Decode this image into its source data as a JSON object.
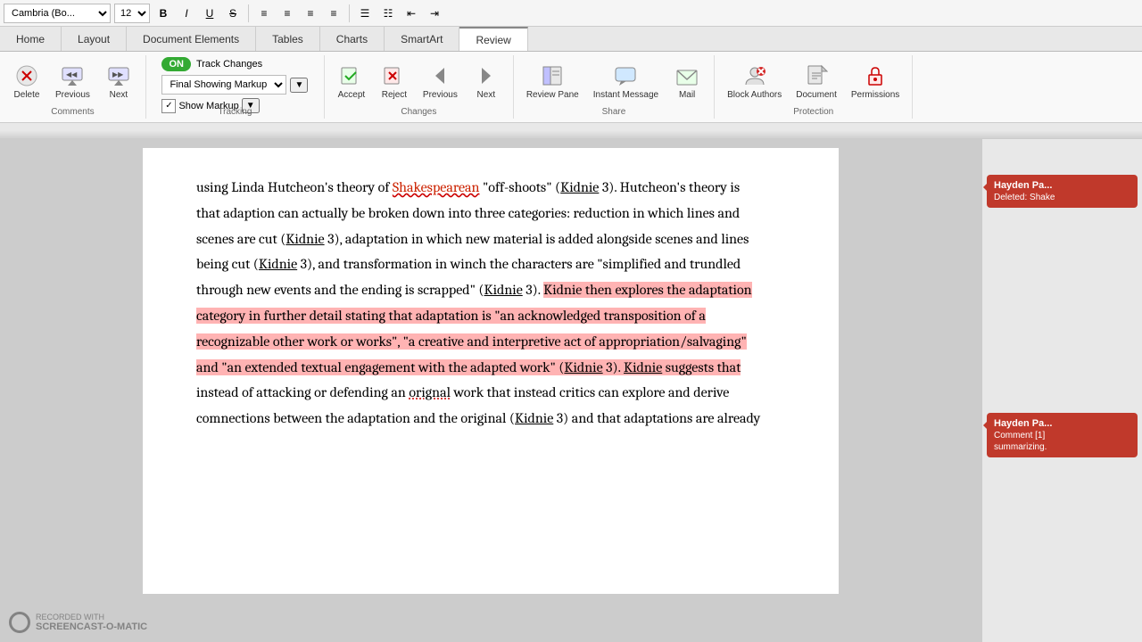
{
  "toolbar": {
    "font_name": "Cambria (Bo...",
    "font_size": "12",
    "bold": "B",
    "italic": "I",
    "underline": "U"
  },
  "tabs": [
    {
      "label": "Home",
      "active": false
    },
    {
      "label": "Layout",
      "active": false
    },
    {
      "label": "Document Elements",
      "active": false
    },
    {
      "label": "Tables",
      "active": false
    },
    {
      "label": "Charts",
      "active": false
    },
    {
      "label": "SmartArt",
      "active": false
    },
    {
      "label": "Review",
      "active": true
    }
  ],
  "ribbon": {
    "groups": [
      {
        "label": "Comments",
        "buttons": [
          {
            "id": "delete",
            "icon": "🗑",
            "label": "Delete"
          },
          {
            "id": "previous",
            "icon": "◀",
            "label": "Previous"
          },
          {
            "id": "next",
            "icon": "▶",
            "label": "Next"
          }
        ]
      },
      {
        "label": "Tracking",
        "track_changes_on": "ON",
        "track_changes_label": "Track Changes",
        "markup_value": "Final Showing Markup",
        "show_markup_label": "Show Markup"
      },
      {
        "label": "Changes",
        "buttons": [
          {
            "id": "accept",
            "icon": "✔",
            "label": "Accept"
          },
          {
            "id": "reject",
            "icon": "✘",
            "label": "Reject"
          },
          {
            "id": "previous",
            "icon": "◀",
            "label": "Previous"
          },
          {
            "id": "next",
            "icon": "▶",
            "label": "Next"
          }
        ]
      },
      {
        "label": "Share",
        "buttons": [
          {
            "id": "review-pane",
            "icon": "📋",
            "label": "Review Pane"
          },
          {
            "id": "instant-message",
            "icon": "💬",
            "label": "Instant Message"
          },
          {
            "id": "mail",
            "icon": "✉",
            "label": "Mail"
          }
        ]
      },
      {
        "label": "Protection",
        "buttons": [
          {
            "id": "block-authors",
            "icon": "🚫",
            "label": "Block Authors"
          },
          {
            "id": "document",
            "icon": "📄",
            "label": "Document"
          },
          {
            "id": "permissions",
            "icon": "🔒",
            "label": "Permissions"
          }
        ]
      }
    ]
  },
  "document": {
    "paragraphs": [
      {
        "id": "p1",
        "segments": [
          {
            "text": "using Linda Hutcheon’s theory of ",
            "style": "normal"
          },
          {
            "text": "Shakespearean",
            "style": "red-link"
          },
          {
            "text": " “off-shoots” (",
            "style": "normal"
          },
          {
            "text": "Kidnie",
            "style": "underline"
          },
          {
            "text": " 3). Hutcheon’s theory is",
            "style": "normal"
          }
        ]
      },
      {
        "id": "p2",
        "segments": [
          {
            "text": "that adaption can actually be broken down into three categories: reduction in which lines and",
            "style": "normal"
          }
        ]
      },
      {
        "id": "p3",
        "segments": [
          {
            "text": "scenes are cut (",
            "style": "normal"
          },
          {
            "text": "Kidnie",
            "style": "underline"
          },
          {
            "text": " 3), adaptation in which new material is added alongside scenes and lines",
            "style": "normal"
          }
        ]
      },
      {
        "id": "p4",
        "segments": [
          {
            "text": "being cut (",
            "style": "normal"
          },
          {
            "text": "Kidnie",
            "style": "underline"
          },
          {
            "text": " 3), and transformation in winch the characters are “simplified and trundled",
            "style": "normal"
          }
        ]
      },
      {
        "id": "p5",
        "segments": [
          {
            "text": "through new events and the ending is scrapped” (",
            "style": "normal"
          },
          {
            "text": "Kidnie",
            "style": "underline"
          },
          {
            "text": " 3). ",
            "style": "normal"
          },
          {
            "text": "Kidnie then explores the adaptation",
            "style": "highlighted"
          }
        ]
      },
      {
        "id": "p6",
        "segments": [
          {
            "text": "category in further detail stating that adaptation is “an acknowledged transposition of a",
            "style": "highlighted"
          }
        ]
      },
      {
        "id": "p7",
        "segments": [
          {
            "text": "recognizable other work or works”, “a creative and interpretive act of appropriation/salvaging”",
            "style": "highlighted"
          }
        ]
      },
      {
        "id": "p8",
        "segments": [
          {
            "text": "and “an extended textual engagement with the adapted work” (",
            "style": "highlighted"
          },
          {
            "text": "Kidnie",
            "style": "highlighted-underline"
          },
          {
            "text": " 3). ",
            "style": "highlighted"
          },
          {
            "text": "Kidnie",
            "style": "highlighted-underline"
          },
          {
            "text": " suggests that",
            "style": "highlighted"
          }
        ]
      },
      {
        "id": "p9",
        "segments": [
          {
            "text": "instead of attacking or defending an ",
            "style": "normal"
          },
          {
            "text": "orignal",
            "style": "red-squiggle"
          },
          {
            "text": " work that instead critics can explore and derive",
            "style": "normal"
          }
        ]
      },
      {
        "id": "p10",
        "segments": [
          {
            "text": "com",
            "style": "normal"
          },
          {
            "text": "nections between the adaptation and the original (",
            "style": "normal"
          },
          {
            "text": "Kidnie",
            "style": "underline"
          },
          {
            "text": " 3) and that adaptations are already",
            "style": "normal"
          }
        ]
      }
    ]
  },
  "comments": [
    {
      "id": "comment1",
      "author": "Hayden Pa...",
      "type": "Deleted:",
      "preview": "Shake",
      "color": "#c0392b"
    },
    {
      "id": "comment2",
      "author": "Hayden Pa...",
      "type": "Comment [1]",
      "preview": "summarizing.",
      "color": "#c0392b"
    }
  ],
  "watermark": {
    "line1": "RECORDED WITH",
    "line2": "SCREENCAST-O-MATIC"
  }
}
